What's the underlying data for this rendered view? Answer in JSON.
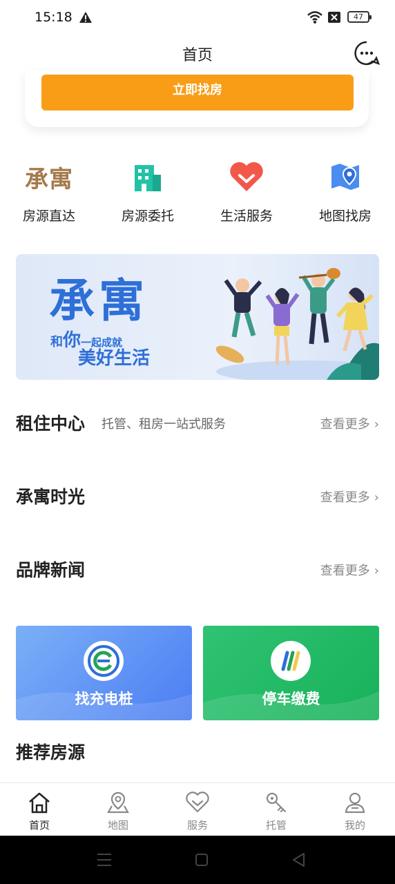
{
  "status_bar": {
    "time": "15:18",
    "battery": "47"
  },
  "nav": {
    "title": "首页"
  },
  "hero": {
    "button_label": "立即找房"
  },
  "quick_links": [
    {
      "label": "房源直达",
      "icon": "brand-logo-icon",
      "brand_text": "承寓"
    },
    {
      "label": "房源委托",
      "icon": "building-icon"
    },
    {
      "label": "生活服务",
      "icon": "heart-icon"
    },
    {
      "label": "地图找房",
      "icon": "map-pin-icon"
    }
  ],
  "banner": {
    "brand": "承寓",
    "line1_prefix": "和",
    "line1_big": "你",
    "line1_rest": "一起成就",
    "line2": "美好生活"
  },
  "sections": [
    {
      "title": "租住中心",
      "subtitle": "托管、租房一站式服务",
      "more": "查看更多"
    },
    {
      "title": "承寓时光",
      "more": "查看更多"
    },
    {
      "title": "品牌新闻",
      "more": "查看更多"
    }
  ],
  "services": [
    {
      "label": "找充电桩",
      "icon": "ev-charger-icon",
      "color": "#4c7df3"
    },
    {
      "label": "停车缴费",
      "icon": "parking-pay-icon",
      "color": "#18b15a"
    }
  ],
  "recommended": {
    "title": "推荐房源"
  },
  "tabs": [
    {
      "label": "首页",
      "icon": "home-icon",
      "active": true
    },
    {
      "label": "地图",
      "icon": "map-icon"
    },
    {
      "label": "服务",
      "icon": "heart-outline-icon"
    },
    {
      "label": "托管",
      "icon": "key-icon"
    },
    {
      "label": "我的",
      "icon": "user-icon"
    }
  ],
  "colors": {
    "accent_orange": "#f99d17",
    "brand_blue": "#2e6fd8",
    "brand_gold": "#a57a4a"
  }
}
